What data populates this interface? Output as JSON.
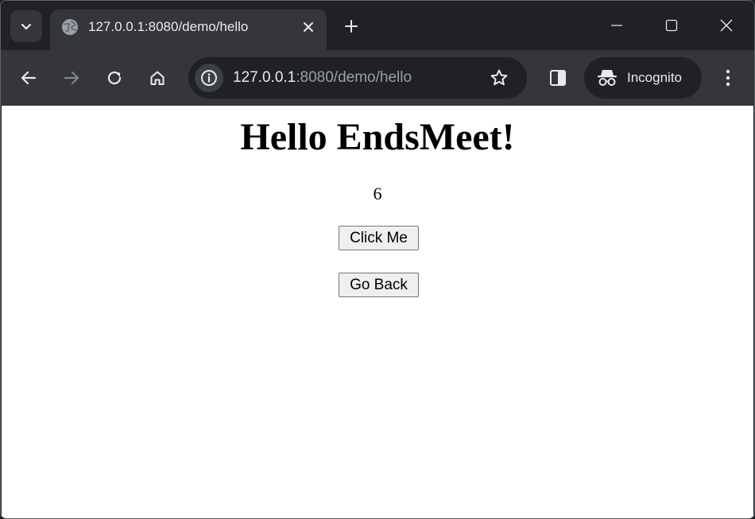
{
  "browser": {
    "tab": {
      "title": "127.0.0.1:8080/demo/hello"
    },
    "omnibox": {
      "host": "127.0.0.1",
      "port_and_path": ":8080/demo/hello"
    },
    "incognito_label": "Incognito",
    "icons": [
      "tab-search-icon",
      "globe-icon",
      "close-icon",
      "plus-icon",
      "minimize-icon",
      "maximize-icon",
      "close-window-icon",
      "back-arrow-icon",
      "forward-arrow-icon",
      "reload-icon",
      "home-icon",
      "info-icon",
      "star-icon",
      "side-panel-icon",
      "incognito-icon",
      "kebab-menu-icon"
    ]
  },
  "page": {
    "heading": "Hello EndsMeet!",
    "counter": "6",
    "click_button": "Click Me",
    "back_button": "Go Back"
  }
}
